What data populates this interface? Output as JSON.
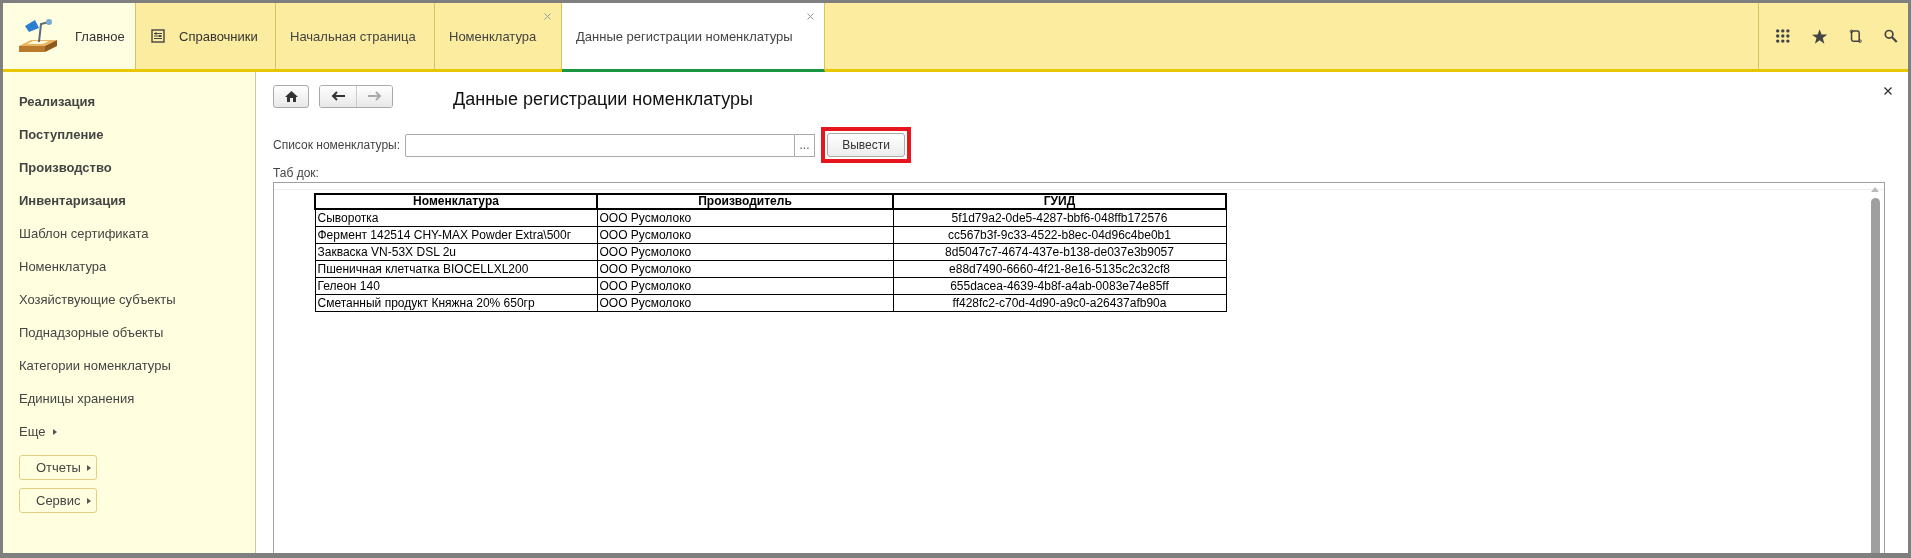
{
  "sections": [
    {
      "label": "Главное",
      "kind": "home"
    },
    {
      "label": "Справочники",
      "kind": "catalog"
    }
  ],
  "tabs": [
    {
      "label": "Начальная страница",
      "selected": false,
      "closable": false
    },
    {
      "label": "Номенклатура",
      "selected": false,
      "closable": true
    },
    {
      "label": "Данные регистрации номенклатуры",
      "selected": true,
      "closable": true
    }
  ],
  "sidebar": {
    "items": [
      {
        "label": "Реализация",
        "kind": "group"
      },
      {
        "label": "Поступление",
        "kind": "group"
      },
      {
        "label": "Производство",
        "kind": "group"
      },
      {
        "label": "Инвентаризация",
        "kind": "group"
      },
      {
        "label": "Шаблон сертификата",
        "kind": "link"
      },
      {
        "label": "Номенклатура",
        "kind": "link"
      },
      {
        "label": "Хозяйствующие субъекты",
        "kind": "link"
      },
      {
        "label": "Поднадзорные объекты",
        "kind": "link"
      },
      {
        "label": "Категории номенклатуры",
        "kind": "link"
      },
      {
        "label": "Единицы хранения",
        "kind": "link"
      },
      {
        "label": "Еще",
        "kind": "more"
      },
      {
        "label": "Отчеты",
        "kind": "button"
      },
      {
        "label": "Сервис",
        "kind": "button"
      }
    ]
  },
  "form": {
    "title": "Данные регистрации номенклатуры",
    "field_label": "Список номенклатуры:",
    "select_button": "...",
    "run_button": {
      "label": "Вывести",
      "highlighted": true
    },
    "spreadsheet_label": "Таб док:"
  },
  "table": {
    "columns": [
      "Номенклатура",
      "Производитель",
      "ГУИД"
    ],
    "rows": [
      [
        "Сыворотка",
        "ООО Русмолоко",
        "5f1d79a2-0de5-4287-bbf6-048ffb172576"
      ],
      [
        "Фермент 142514 CHY-MAX Powder Extra\\500г",
        "ООО Русмолоко",
        "cc567b3f-9c33-4522-b8ec-04d96c4be0b1"
      ],
      [
        "Закваска VN-53X DSL 2u",
        "ООО Русмолоко",
        "8d5047c7-4674-437e-b138-de037e3b9057"
      ],
      [
        "Пшеничная клетчатка BIOCELLXL200",
        "ООО Русмолоко",
        "e88d7490-6660-4f21-8e16-5135c2c32cf8"
      ],
      [
        "Гелеон 140",
        "ООО Русмолоко",
        "655dacea-4639-4b8f-a4ab-0083e74e85ff"
      ],
      [
        "Сметанный продукт Княжна 20% 650гр",
        "ООО Русмолоко",
        "ff428fc2-c70d-4d90-a9c0-a26437afb90a"
      ]
    ]
  }
}
